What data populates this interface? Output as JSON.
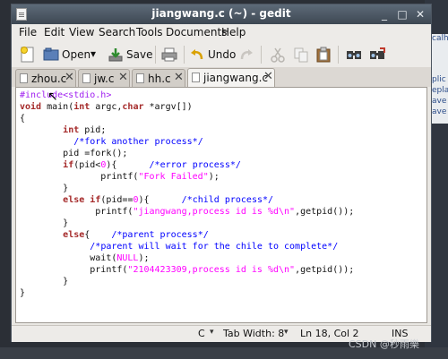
{
  "window": {
    "title": "jiangwang.c (~) - gedit",
    "minimize": "_",
    "maximize": "□",
    "close": "✕"
  },
  "menubar": [
    "File",
    "Edit",
    "View",
    "Search",
    "Tools",
    "Documents",
    "Help"
  ],
  "toolbar": {
    "open_label": "Open",
    "save_label": "Save",
    "undo_label": "Undo",
    "dropdown": "▾"
  },
  "tabs": [
    {
      "label": "zhou.c",
      "close": "✕"
    },
    {
      "label": "jw.c",
      "close": "✕"
    },
    {
      "label": "hh.c",
      "close": "✕"
    },
    {
      "label": "jiangwang.c",
      "close": "✕"
    }
  ],
  "code_lines": [
    "#include<stdio.h>",
    "void main(int argc,char *argv[])",
    "{",
    "        int pid;",
    "          /*fork another process*/",
    "        pid =fork();",
    "        if(pid<0){      /*error process*/",
    "               printf(\"Fork Failed\");",
    "        }",
    "        else if(pid==0){      /*child process*/",
    "              printf(\"jiangwang,process id is %d\\n\",getpid());",
    "        }",
    "        else{    /*parent process*/",
    "             /*parent will wait for the chile to complete*/",
    "             wait(NULL);",
    "             printf(\"2104423309,process id is %d\\n\",getpid());",
    "        }",
    "}"
  ],
  "statusbar": {
    "language": "C",
    "tab_width": "Tab Width:  8",
    "position": "Ln 18, Col 2",
    "mode": "INS"
  },
  "background": {
    "fragments": [
      "calh",
      "plic",
      "epla",
      "ave",
      "ave"
    ]
  },
  "watermark": "CSDN @秒雨樂"
}
